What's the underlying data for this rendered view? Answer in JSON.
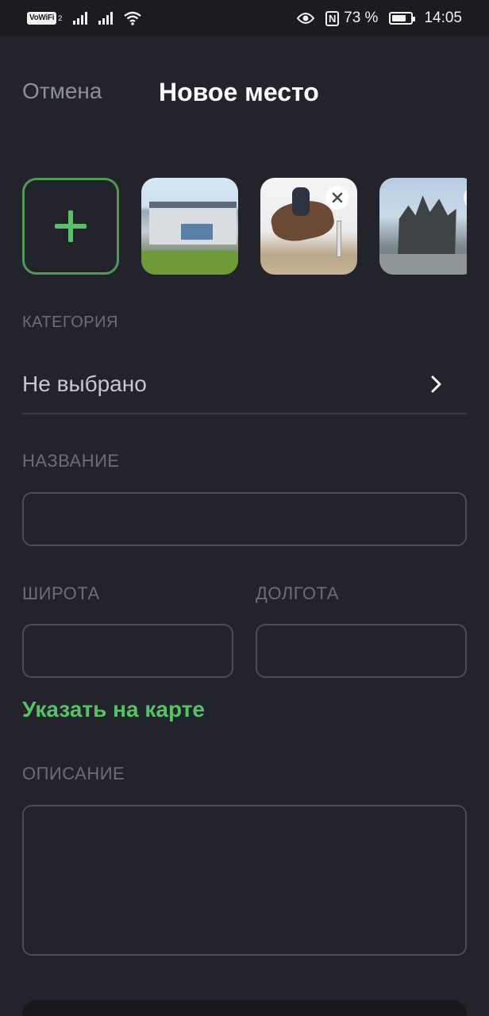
{
  "status_bar": {
    "vowifi": "VoWiFi",
    "vowifi_sub": "2",
    "nfc": "N",
    "battery": "73 %",
    "battery_level": 0.73,
    "time": "14:05"
  },
  "header": {
    "cancel_label": "Отмена",
    "title": "Новое место"
  },
  "photos": {
    "add_icon": "plus-icon",
    "remove_icon": "close-icon",
    "items": [
      {
        "subject": "building"
      },
      {
        "subject": "show-jumping-horse"
      },
      {
        "subject": "horse-statue"
      }
    ]
  },
  "form": {
    "category": {
      "label": "КАТЕГОРИЯ",
      "value": "Не выбрано",
      "icon": "chevron-right-icon"
    },
    "name": {
      "label": "НАЗВАНИЕ",
      "value": ""
    },
    "latitude": {
      "label": "ШИРОТА",
      "value": ""
    },
    "longitude": {
      "label": "ДОЛГОТА",
      "value": ""
    },
    "map_link": "Указать на карте",
    "description": {
      "label": "ОПИСАНИЕ",
      "value": ""
    }
  },
  "colors": {
    "background": "#22232b",
    "accent": "#58c168",
    "muted_text": "#6c6d78",
    "border": "#4b4c57"
  }
}
